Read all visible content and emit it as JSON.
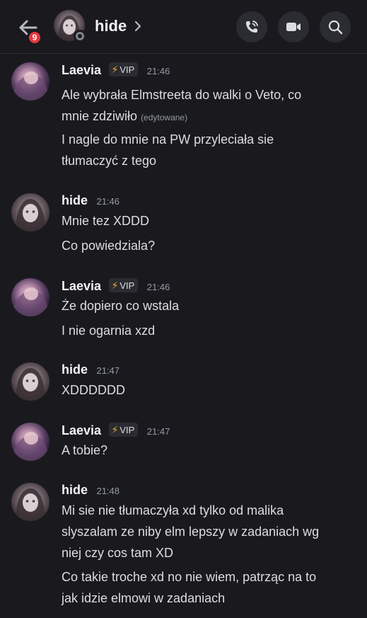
{
  "header": {
    "badge_count": "9",
    "title": "hide",
    "chevron": "›",
    "icons": [
      "back-arrow-icon",
      "phone-call-icon",
      "video-camera-icon",
      "search-icon"
    ]
  },
  "messages": [
    {
      "author": "Laevia",
      "vip": "VIP",
      "time": "21:46",
      "lines": [
        "Ale wybrała Elmstreeta do walki o Veto, co",
        "mnie zdziwiło",
        "I nagle do mnie na PW przyleciała sie",
        "tłumaczyć z tego"
      ],
      "edited": "(edytowane)"
    },
    {
      "author": "hide",
      "time": "21:46",
      "lines": [
        "Mnie tez XDDD",
        "Co powiedziala?"
      ]
    },
    {
      "author": "Laevia",
      "vip": "VIP",
      "time": "21:46",
      "lines": [
        "Że dopiero co wstala",
        "I nie ogarnia xzd"
      ]
    },
    {
      "author": "hide",
      "time": "21:47",
      "lines": [
        "XDDDDDD"
      ]
    },
    {
      "author": "Laevia",
      "vip": "VIP",
      "time": "21:47",
      "lines": [
        "A tobie?"
      ]
    },
    {
      "author": "hide",
      "time": "21:48",
      "lines": [
        "Mi sie nie tłumaczyła xd tylko od malika",
        "slyszalam ze niby elm lepszy w zadaniach wg",
        "niej czy cos tam XD",
        "Co takie troche xd no nie wiem, patrząc na to",
        "jak idzie elmowi w zadaniach"
      ]
    }
  ],
  "colors": {
    "background": "#1a1a1e",
    "badge": "#e8363f",
    "vip_bolt": "#f0b232",
    "text": "#dcdde1",
    "muted": "#949ba4"
  }
}
